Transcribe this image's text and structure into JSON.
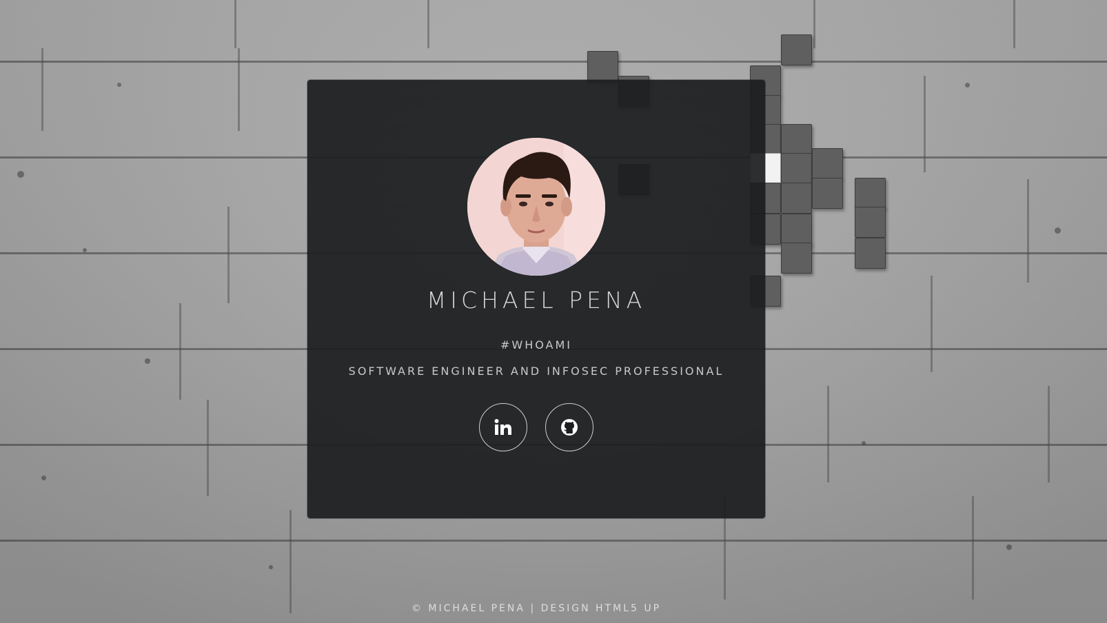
{
  "profile": {
    "name": "MICHAEL PENA",
    "tagline": "#WHOAMI",
    "role": "SOFTWARE ENGINEER AND INFOSEC PROFESSIONAL"
  },
  "socials": [
    {
      "label": "LinkedIn",
      "icon": "linkedin-icon"
    },
    {
      "label": "GitHub",
      "icon": "github-icon"
    }
  ],
  "footer": {
    "copyright": "© MICHAEL PENA",
    "separator": "|",
    "design_prefix": "DESIGN",
    "design_link": "HTML5 UP"
  },
  "colors": {
    "card_bg": "#1b1d20",
    "text": "#d8d8d8",
    "wall": "#a9a9a9"
  }
}
